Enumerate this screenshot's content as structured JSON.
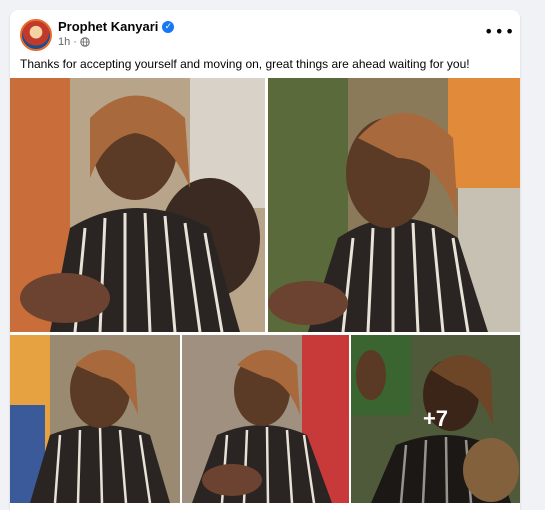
{
  "post": {
    "author": "Prophet Kanyari",
    "time": "1h",
    "separator": "·",
    "caption": "Thanks for accepting yourself and moving on, great things are ahead waiting for you!",
    "more_menu": "•••",
    "verified_mark": "✓"
  },
  "gallery": {
    "extra_count": "+7",
    "photos": [
      {
        "alt": "woman in striped shirt clapping"
      },
      {
        "alt": "woman in striped shirt clapping"
      },
      {
        "alt": "woman in striped shirt"
      },
      {
        "alt": "woman in striped shirt clapping"
      },
      {
        "alt": "woman in striped shirt raising hands"
      }
    ]
  },
  "icons": {
    "avatar": "avatar",
    "verified": "verified-badge-icon",
    "globe": "globe-icon",
    "more": "more-options-icon"
  },
  "colors": {
    "accent": "#1877f2",
    "text": "#050505",
    "muted": "#65676b",
    "background": "#f0f2f5"
  }
}
